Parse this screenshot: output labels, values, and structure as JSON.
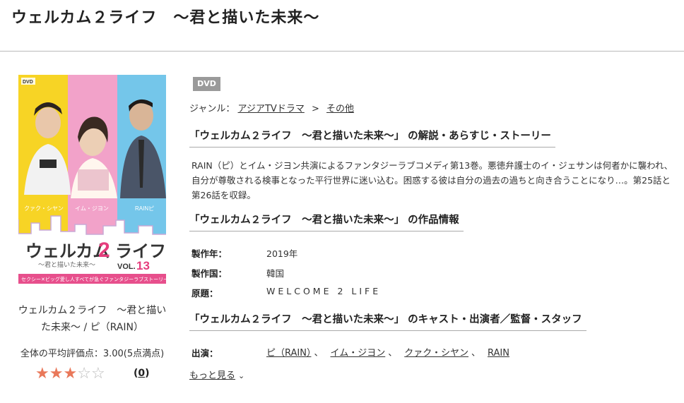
{
  "page": {
    "title": "ウェルカム２ライフ　～君と描いた未来～"
  },
  "cover": {
    "badge": "DVD",
    "logo_top": "ウェルカム",
    "logo_num": "2",
    "logo_right": "ライフ",
    "logo_sub": "～君と描いた未来～",
    "vol_label": "VOL.",
    "vol_num": "13",
    "names": [
      "クァク・シヤン",
      "イム・ジヨン",
      "RAINピ"
    ],
    "tagline": "セクシー✕ビッグ愛し人すべてが急ぐファンタジーラブストーリー",
    "colors": {
      "yellow": "#f7d425",
      "pink": "#f2a2c9",
      "blue": "#74c6ea",
      "bottom": "#ffffff",
      "accent": "#e53d7d"
    }
  },
  "caption": {
    "line1": "ウェルカム２ライフ　～君と描い",
    "line2": "た未来～ / ピ（RAIN）"
  },
  "rating": {
    "avg_text": "全体の平均評価点：3.00(5点満点)",
    "stars_filled": 3,
    "stars_total": 5,
    "count_text": "0",
    "paren_open": "(",
    "paren_close": ")"
  },
  "badge": {
    "label": "DVD"
  },
  "genre": {
    "label": "ジャンル：",
    "crumb1": "アジアTVドラマ",
    "sep": ">",
    "crumb2": "その他"
  },
  "sections": {
    "synopsis_heading": "「ウェルカム２ライフ　～君と描いた未来～」 の解説・あらすじ・ストーリー",
    "synopsis_text": "RAIN（ピ）とイム・ジヨン共演によるファンタジーラブコメディ第13巻。悪徳弁護士のイ・ジェサンは何者かに襲われ、自分が尊敬される検事となった平行世界に迷い込む。困惑する彼は自分の過去の過ちと向き合うことになり…。第25話と第26話を収録。",
    "info_heading": "「ウェルカム２ライフ　～君と描いた未来～」 の作品情報",
    "cast_heading": "「ウェルカム２ライフ　～君と描いた未来～」 のキャスト・出演者／監督・スタッフ"
  },
  "info": {
    "year_label": "製作年：",
    "year_value": "2019年",
    "country_label": "製作国：",
    "country_value": "韓国",
    "original_label": "原題：",
    "original_value": "WELCOME 2 LIFE"
  },
  "cast": {
    "label": "出演：",
    "members": [
      "ピ（RAIN）",
      "イム・ジヨン",
      "クァク・シヤン",
      "RAIN"
    ],
    "separator": "、"
  },
  "more": {
    "label": "もっと見る",
    "icon": "chevron-down-icon"
  }
}
